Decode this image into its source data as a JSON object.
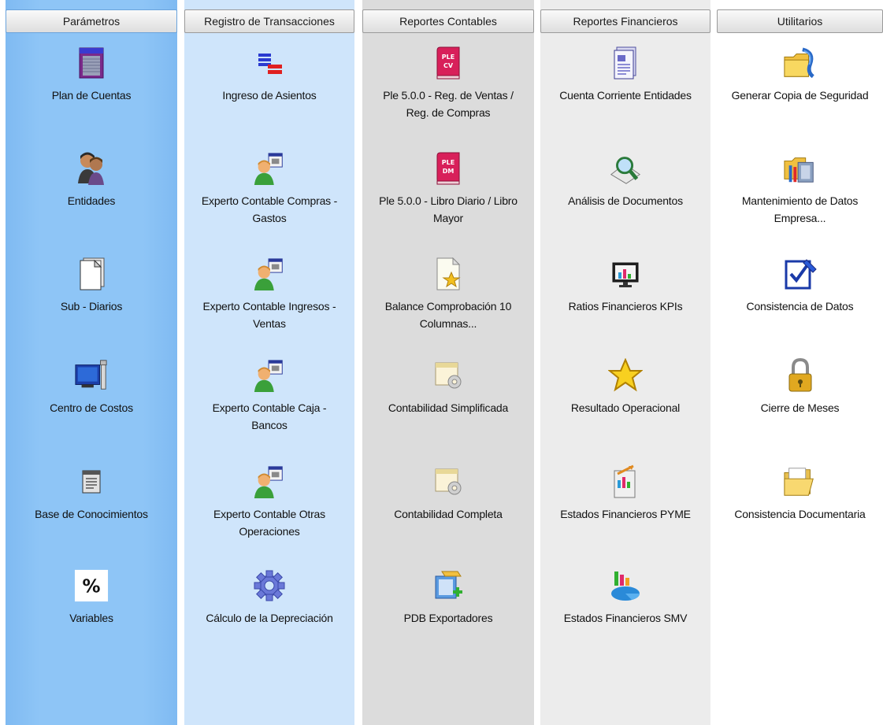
{
  "columns": [
    {
      "title": "Parámetros",
      "items": [
        {
          "label": "Plan de Cuentas",
          "icon": "ledger-grid-icon"
        },
        {
          "label": "Entidades",
          "icon": "people-icon"
        },
        {
          "label": "Sub - Diarios",
          "icon": "document-icon"
        },
        {
          "label": "Centro de Costos",
          "icon": "computer-tools-icon"
        },
        {
          "label": "Base de Conocimientos",
          "icon": "notepad-icon"
        },
        {
          "label": "Variables",
          "icon": "percent-icon"
        }
      ]
    },
    {
      "title": "Registro de Transacciones",
      "items": [
        {
          "label": "Ingreso de Asientos",
          "icon": "entries-icon"
        },
        {
          "label": "Experto Contable Compras -\nGastos",
          "icon": "expert-user-icon"
        },
        {
          "label": "Experto Contable Ingresos -\nVentas",
          "icon": "expert-user-icon"
        },
        {
          "label": "Experto Contable Caja -\nBancos",
          "icon": "expert-user-icon"
        },
        {
          "label": "Experto Contable Otras\nOperaciones",
          "icon": "expert-user-icon"
        },
        {
          "label": "Cálculo de la Depreciación",
          "icon": "gear-icon"
        }
      ]
    },
    {
      "title": "Reportes Contables",
      "items": [
        {
          "label": "Ple 5.0.0 - Reg. de Ventas /\nReg. de Compras",
          "icon": "ple-cv-book-icon",
          "badge": "PLE\nCV"
        },
        {
          "label": "Ple 5.0.0 - Libro Diario / Libro\nMayor",
          "icon": "ple-dm-book-icon",
          "badge": "PLE\nDM"
        },
        {
          "label": "Balance Comprobación 10\nColumnas...",
          "icon": "report-star-icon"
        },
        {
          "label": "Contabilidad Simplificada",
          "icon": "window-gear-icon"
        },
        {
          "label": "Contabilidad Completa",
          "icon": "window-gear-icon"
        },
        {
          "label": "PDB Exportadores",
          "icon": "export-folder-icon"
        }
      ]
    },
    {
      "title": "Reportes Financieros",
      "items": [
        {
          "label": "Cuenta Corriente Entidades",
          "icon": "report-document-icon"
        },
        {
          "label": "Análisis de Documentos",
          "icon": "magnifier-icon"
        },
        {
          "label": "Ratios Financieros KPIs",
          "icon": "monitor-chart-icon"
        },
        {
          "label": "Resultado Operacional",
          "icon": "star-icon"
        },
        {
          "label": "Estados Financieros  PYME",
          "icon": "chart-document-icon"
        },
        {
          "label": "Estados Financieros SMV",
          "icon": "pie-chart-icon"
        }
      ]
    },
    {
      "title": "Utilitarios",
      "items": [
        {
          "label": "Generar Copia de Seguridad",
          "icon": "backup-folder-icon"
        },
        {
          "label": "Mantenimiento de Datos\nEmpresa...",
          "icon": "folder-tools-icon"
        },
        {
          "label": "Consistencia de Datos",
          "icon": "checklist-icon"
        },
        {
          "label": "Cierre de Meses",
          "icon": "padlock-icon"
        },
        {
          "label": "Consistencia Documentaria",
          "icon": "open-folder-icon"
        }
      ]
    }
  ]
}
